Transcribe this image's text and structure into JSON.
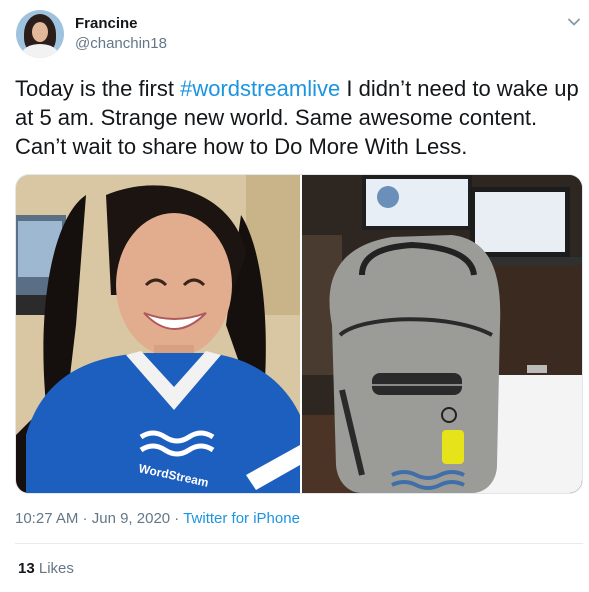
{
  "author": {
    "name": "Francine",
    "handle": "@chanchin18"
  },
  "tweet": {
    "text_before": "Today is the first ",
    "hashtag": "#wordstreamlive",
    "text_after": " I didn’t need to wake up at 5 am. Strange new world. Same awesome content. Can’t wait to share how to Do More With Less."
  },
  "media": {
    "shirt_logo_text": "WordStream"
  },
  "meta": {
    "time": "10:27 AM",
    "separator": " · ",
    "date": "Jun 9, 2020",
    "source": "Twitter for iPhone"
  },
  "stats": {
    "likes_count": "13",
    "likes_label": "Likes"
  },
  "colors": {
    "link": "#1b95e0",
    "secondary_text": "#657786",
    "shirt_blue": "#1d5fbf"
  },
  "icons": {
    "more": "chevron-down-icon"
  }
}
